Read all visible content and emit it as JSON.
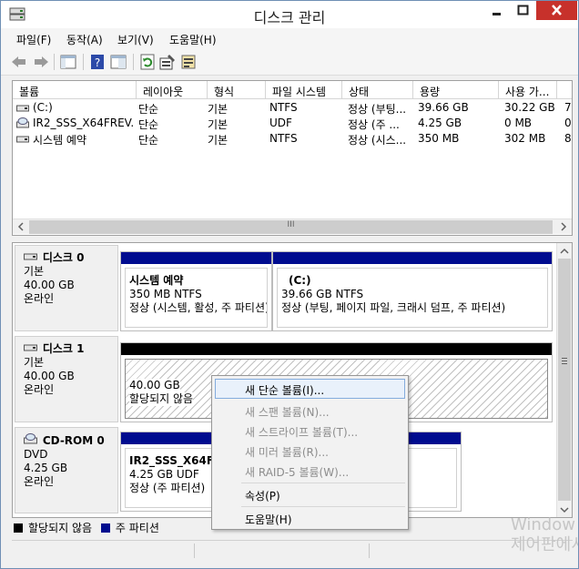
{
  "window": {
    "title": "디스크 관리",
    "controls": {
      "minimize": "_",
      "maximize": "□",
      "close": "✕"
    }
  },
  "menubar": [
    {
      "label": "파일(F)"
    },
    {
      "label": "동작(A)"
    },
    {
      "label": "보기(V)"
    },
    {
      "label": "도움말(H)"
    }
  ],
  "toolbar": {
    "icons": [
      "back-icon",
      "forward-icon",
      "show-hide-console-tree-icon",
      "help-icon",
      "properties-list-icon",
      "refresh-icon",
      "properties-icon",
      "rescan-disks-icon"
    ]
  },
  "volume_list": {
    "columns": [
      "볼륨",
      "레이아웃",
      "형식",
      "파일 시스템",
      "상태",
      "용량",
      "사용 가...",
      ""
    ],
    "rows": [
      {
        "icon": "drive-icon",
        "name": "(C:)",
        "layout": "단순",
        "type": "기본",
        "fs": "NTFS",
        "status": "정상 (부팅...",
        "capacity": "39.66 GB",
        "free": "30.22 GB",
        "pct": "7"
      },
      {
        "icon": "cd-icon",
        "name": "IR2_SSS_X64FREV...",
        "layout": "단순",
        "type": "기본",
        "fs": "UDF",
        "status": "정상 (주 ...",
        "capacity": "4.25 GB",
        "free": "0 MB",
        "pct": "0"
      },
      {
        "icon": "drive-icon",
        "name": "시스템 예약",
        "layout": "단순",
        "type": "기본",
        "fs": "NTFS",
        "status": "정상 (시스...",
        "capacity": "350 MB",
        "free": "302 MB",
        "pct": "8"
      }
    ],
    "scroll_thumb_glyph": "III"
  },
  "disks": [
    {
      "name": "디스크 0",
      "type": "기본",
      "size": "40.00 GB",
      "state": "온라인",
      "partitions": [
        {
          "title": "시스템 예약",
          "line1": "350 MB NTFS",
          "line2": "정상 (시스템, 활성, 주 파티션)"
        },
        {
          "title": "(C:)",
          "line1": "39.66 GB NTFS",
          "line2": "정상 (부팅, 페이지 파일, 크래시 덤프, 주 파티션)"
        }
      ]
    },
    {
      "name": "디스크 1",
      "type": "기본",
      "size": "40.00 GB",
      "state": "온라인",
      "partitions": [
        {
          "line1": "40.00 GB",
          "line2": "할당되지 않음"
        }
      ]
    },
    {
      "name": "CD-ROM 0",
      "type": "DVD",
      "size": "4.25 GB",
      "state": "온라인",
      "partitions": [
        {
          "title": "IR2_SSS_X64FREV",
          "line1": "4.25 GB UDF",
          "line2": "정상 (주 파티션)"
        }
      ]
    }
  ],
  "legend": [
    {
      "label": "할당되지 않음",
      "color": "#000000"
    },
    {
      "label": "주 파티션",
      "color": "#000c8f"
    }
  ],
  "context_menu": [
    {
      "label": "새 단순 볼륨(I)...",
      "enabled": true,
      "highlighted": true
    },
    {
      "label": "새 스팬 볼륨(N)...",
      "enabled": false
    },
    {
      "label": "새 스트라이프 볼륨(T)...",
      "enabled": false
    },
    {
      "label": "새 미러 볼륨(R)...",
      "enabled": false
    },
    {
      "label": "새 RAID-5 볼륨(W)...",
      "enabled": false
    },
    {
      "label": "속성(P)",
      "enabled": true
    },
    {
      "label": "도움말(H)",
      "enabled": true
    }
  ],
  "watermark": {
    "line1": "Window",
    "line2": "제어판에서"
  }
}
